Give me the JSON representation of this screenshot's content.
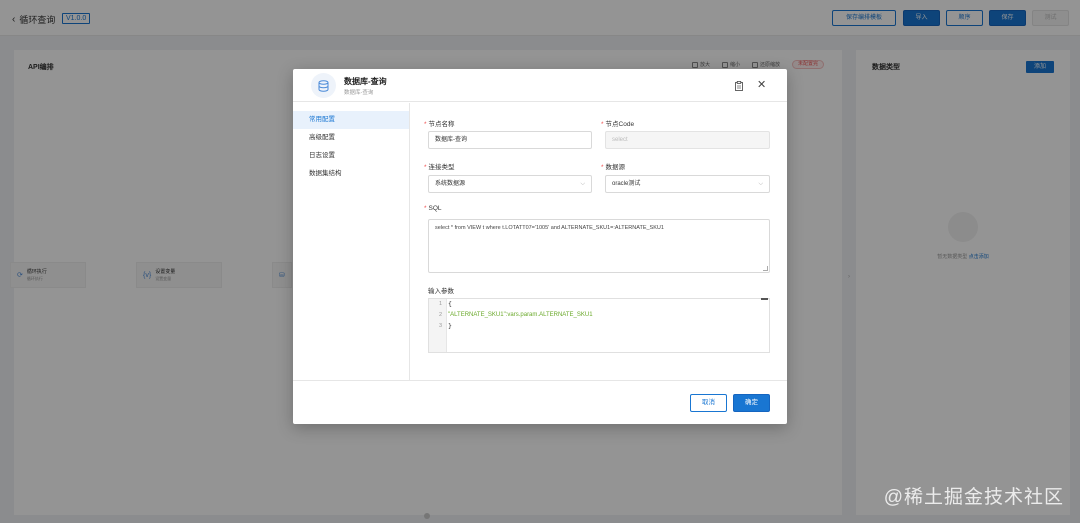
{
  "header": {
    "back_label": "循环查询",
    "version": "V1.0.0",
    "buttons": {
      "save_template": "保存编排模板",
      "import": "导入",
      "sort": "顺序",
      "save": "保存",
      "test": "测试"
    }
  },
  "left_panel": {
    "title": "API编排",
    "tools": [
      "放大",
      "缩小",
      "还原缩放"
    ],
    "badge": "未配置完",
    "nodes": [
      {
        "title": "循环执行",
        "sub": "循环执行"
      },
      {
        "title": "设置变量",
        "sub": "设置变量"
      }
    ]
  },
  "right_panel": {
    "title": "数据类型",
    "add_label": "添加",
    "empty_text": "暂无数据类型",
    "empty_link": "点击添加"
  },
  "modal": {
    "title": "数据库-查询",
    "subtitle": "数据库-查询",
    "side_menu": [
      "常用配置",
      "高级配置",
      "日志设置",
      "数据集结构"
    ],
    "fields": {
      "node_name": {
        "label": "节点名称",
        "value": "数据库-查询"
      },
      "node_code": {
        "label": "节点Code",
        "value": "select"
      },
      "conn_type": {
        "label": "连接类型",
        "value": "系统数据源"
      },
      "datasource": {
        "label": "数据源",
        "value": "oracle测试"
      },
      "sql": {
        "label": "SQL",
        "value": "select * from VIEW t where t.LOTATT07='1005' and ALTERNATE_SKU1=:ALTERNATE_SKU1"
      },
      "input_params": {
        "label": "输入参数",
        "line_numbers": [
          "1",
          "2",
          "3"
        ],
        "lines": [
          "{",
          "\"ALTERNATE_SKU1\":vars.param.ALTERNATE_SKU1",
          "}"
        ]
      }
    },
    "cancel_label": "取消",
    "ok_label": "确定"
  },
  "watermark": "@稀土掘金技术社区",
  "colors": {
    "primary": "#1976d2",
    "required": "#f05050",
    "code_string": "#6aa92a"
  }
}
